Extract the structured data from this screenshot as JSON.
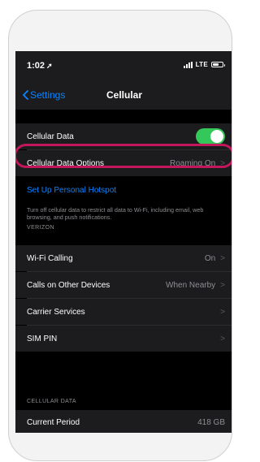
{
  "status_bar": {
    "time": "1:02",
    "network": "LTE"
  },
  "nav": {
    "back_label": "Settings",
    "title": "Cellular"
  },
  "cells": {
    "cellular_data": {
      "label": "Cellular Data",
      "toggle_on": true
    },
    "cellular_data_options": {
      "label": "Cellular Data Options",
      "value": "Roaming On"
    },
    "hotspot": {
      "label": "Set Up Personal Hotspot"
    },
    "footer": "Turn off cellular data to restrict all data to Wi-Fi, including email, web browsing, and push notifications.",
    "carrier_header": "VERIZON",
    "wifi_calling": {
      "label": "Wi-Fi Calling",
      "value": "On"
    },
    "calls_other_devices": {
      "label": "Calls on Other Devices",
      "value": "When Nearby"
    },
    "carrier_services": {
      "label": "Carrier Services"
    },
    "sim_pin": {
      "label": "SIM PIN"
    },
    "usage_header": "CELLULAR DATA",
    "current_period": {
      "label": "Current Period",
      "value": "418 GB"
    }
  },
  "colors": {
    "accent": "#0a84ff",
    "toggle_on": "#34c759",
    "highlight": "#c2185b"
  },
  "icons": [
    "location-arrow-icon",
    "signal-icon",
    "battery-icon",
    "chevron-left-icon",
    "chevron-right-icon"
  ]
}
